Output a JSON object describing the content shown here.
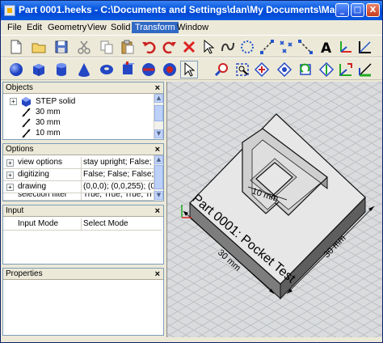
{
  "window": {
    "title": "Part 0001.heeks - C:\\Documents and Settings\\dan\\My Documents\\Machi",
    "minimize_glyph": "_",
    "maximize_glyph": "□",
    "close_glyph": "X"
  },
  "menubar": {
    "items": [
      {
        "label": "File"
      },
      {
        "label": "Edit"
      },
      {
        "label": "Geometry"
      },
      {
        "label": "View"
      },
      {
        "label": "Solid"
      },
      {
        "label": "Transform",
        "active": true
      },
      {
        "label": "Window"
      }
    ]
  },
  "toolbar_top": {
    "icons": [
      "new-file-icon",
      "open-folder-icon",
      "save-icon",
      "cut-icon",
      "copy-icon",
      "paste-icon",
      "undo-icon",
      "redo-icon",
      "delete-icon",
      "select-arrow-icon",
      "spline-icon",
      "circle-dotted-icon",
      "line-points-icon",
      "points-icon",
      "text-icon",
      "coord-system-icon"
    ]
  },
  "toolbar_bottom": {
    "icons": [
      "sphere-icon",
      "cube-icon",
      "cylinder-icon",
      "cone-icon",
      "torus-icon",
      "union-icon",
      "subtract-icon",
      "intersect-icon",
      "fuse-icon",
      "move-icon",
      "zoom-window-icon",
      "pan-icon",
      "zoom-icon",
      "rotate-view-icon",
      "fly-icon",
      "fit-view-icon",
      "view-back-icon",
      "ruler-icon"
    ]
  },
  "objects_panel": {
    "title": "Objects",
    "close_glyph": "×",
    "items": [
      {
        "label": "STEP solid",
        "expander": "+",
        "icon": "solid-icon"
      },
      {
        "label": "30 mm",
        "icon": "dimension-icon"
      },
      {
        "label": "30 mm",
        "icon": "dimension-icon"
      },
      {
        "label": "10 mm",
        "icon": "dimension-icon"
      }
    ]
  },
  "options_panel": {
    "title": "Options",
    "close_glyph": "×",
    "rows": [
      {
        "name": "view options",
        "value": "stay upright; False; F"
      },
      {
        "name": "digitizing",
        "value": "False; False; False; F"
      },
      {
        "name": "drawing",
        "value": "(0,0,0); (0,0,255); (0"
      },
      {
        "name": "selection filter",
        "value": "True; True; True; Tr"
      }
    ],
    "expander": "+"
  },
  "input_panel": {
    "title": "Input",
    "close_glyph": "×",
    "rows": [
      {
        "name": "Input Mode",
        "value": "Select Mode"
      }
    ]
  },
  "properties_panel": {
    "title": "Properties",
    "close_glyph": "×"
  },
  "viewport": {
    "part_label": "Part 0001: Pocket Test",
    "dimension_inner": "10 mm",
    "dimension_bottom": "30 mm",
    "dimension_right": "30 mm"
  },
  "colors": {
    "title_bar": "#0a5ae0",
    "menu_active": "#316ac5",
    "part_face": "#e6e6e6",
    "part_side": "#8a8a8a"
  }
}
